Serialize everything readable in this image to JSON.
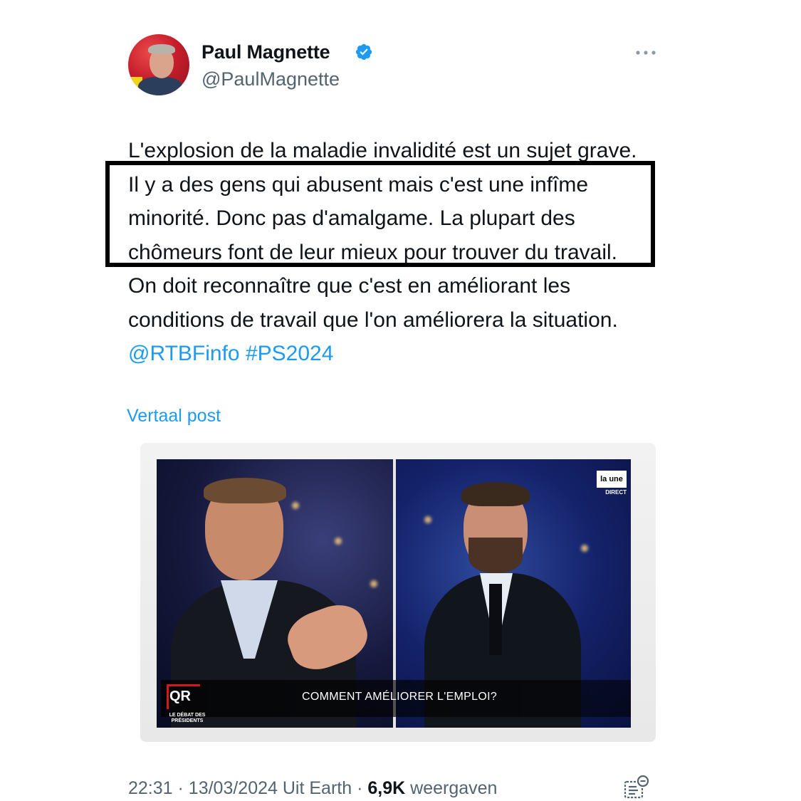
{
  "author": {
    "name": "Paul Magnette",
    "handle": "@PaulMagnette",
    "verified": true,
    "avatar_icon": "profile-photo"
  },
  "more_icon": "more-horizontal-icon",
  "tweet": {
    "text_before_links": "L'explosion de la maladie invalidité est un sujet grave. Il y a des gens qui abusent mais c'est une infîme minorité. Donc pas d'amalgame. La plupart des chômeurs font de leur mieux pour trouver du travail. On doit reconnaître que c'est en améliorant les conditions de travail que l'on améliorera la situation.",
    "mention": "@RTBFinfo",
    "hashtag": "#PS2024",
    "translate_label": "Vertaal post"
  },
  "media": {
    "channel_logo": "la une",
    "channel_sub": "DIRECT",
    "show_logo": "QR",
    "show_sub": "LE DÉBAT DES PRÉSIDENTS",
    "caption": "COMMENT AMÉLIORER L'EMPLOI?"
  },
  "meta": {
    "time": "22:31",
    "date": "13/03/2024",
    "source": "Uit Earth",
    "views_count": "6,9K",
    "views_label": "weergaven",
    "stats_icon": "analytics-icon"
  },
  "colors": {
    "accent": "#1d9bf0",
    "text": "#0f1419",
    "muted": "#536471",
    "highlight_border": "#000000"
  }
}
